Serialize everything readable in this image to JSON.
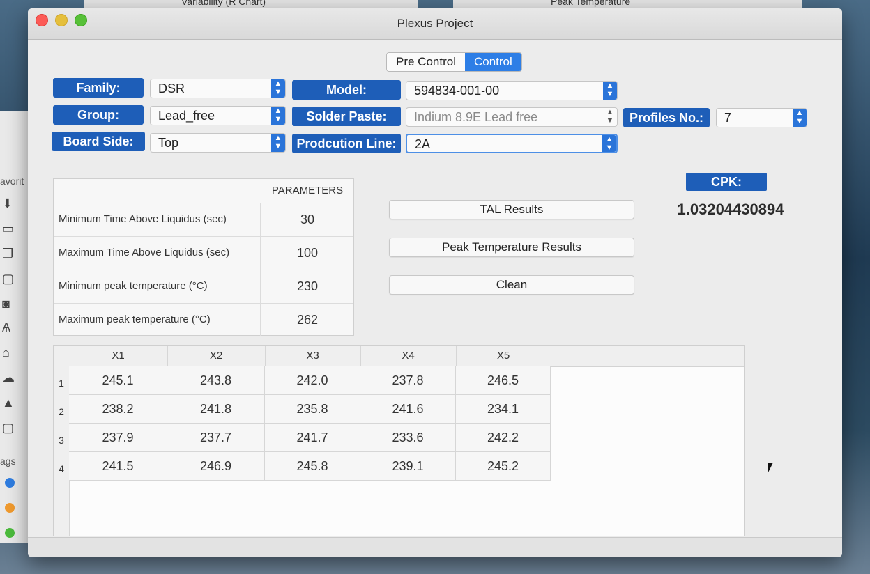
{
  "background": {
    "top_left_window_title": "Variability (R Chart)",
    "top_right_window_title": "Peak Temperature",
    "sidebar_favorites": "avorit",
    "sidebar_tags": "ags"
  },
  "window": {
    "title": "Plexus Project"
  },
  "tabs": [
    "Pre Control",
    "Control"
  ],
  "active_tab": "Control",
  "form": {
    "family_label": "Family:",
    "family_value": "DSR",
    "group_label": "Group:",
    "group_value": "Lead_free",
    "board_side_label": "Board Side:",
    "board_side_value": "Top",
    "model_label": "Model:",
    "model_value": "594834-001-00",
    "solder_paste_label": "Solder Paste:",
    "solder_paste_value": "Indium 8.9E Lead free",
    "production_line_label": "Prodcution Line:",
    "production_line_value": "2A",
    "profiles_no_label": "Profiles No.:",
    "profiles_no_value": "7"
  },
  "parameters": {
    "header": "PARAMETERS",
    "rows": [
      {
        "label": "Minimum Time Above Liquidus (sec)",
        "value": "30"
      },
      {
        "label": "Maximum Time Above Liquidus (sec)",
        "value": "100"
      },
      {
        "label": "Minimum peak temperature (°C)",
        "value": "230"
      },
      {
        "label": "Maximum peak temperature (°C)",
        "value": "262"
      }
    ]
  },
  "buttons": {
    "tal_results": "TAL Results",
    "peak_temperature_results": "Peak Temperature Results",
    "clean": "Clean"
  },
  "cpk": {
    "label": "CPK:",
    "value": "1.03204430894"
  },
  "grid": {
    "columns": [
      "X1",
      "X2",
      "X3",
      "X4",
      "X5"
    ],
    "rows": [
      {
        "num": "1",
        "cells": [
          "245.1",
          "243.8",
          "242.0",
          "237.8",
          "246.5"
        ]
      },
      {
        "num": "2",
        "cells": [
          "238.2",
          "241.8",
          "235.8",
          "241.6",
          "234.1"
        ]
      },
      {
        "num": "3",
        "cells": [
          "237.9",
          "237.7",
          "241.7",
          "233.6",
          "242.2"
        ]
      },
      {
        "num": "4",
        "cells": [
          "241.5",
          "246.9",
          "245.8",
          "239.1",
          "245.2"
        ]
      }
    ]
  },
  "colors": {
    "label_blue": "#1e5eb8",
    "accent_blue": "#2d7ee6"
  }
}
